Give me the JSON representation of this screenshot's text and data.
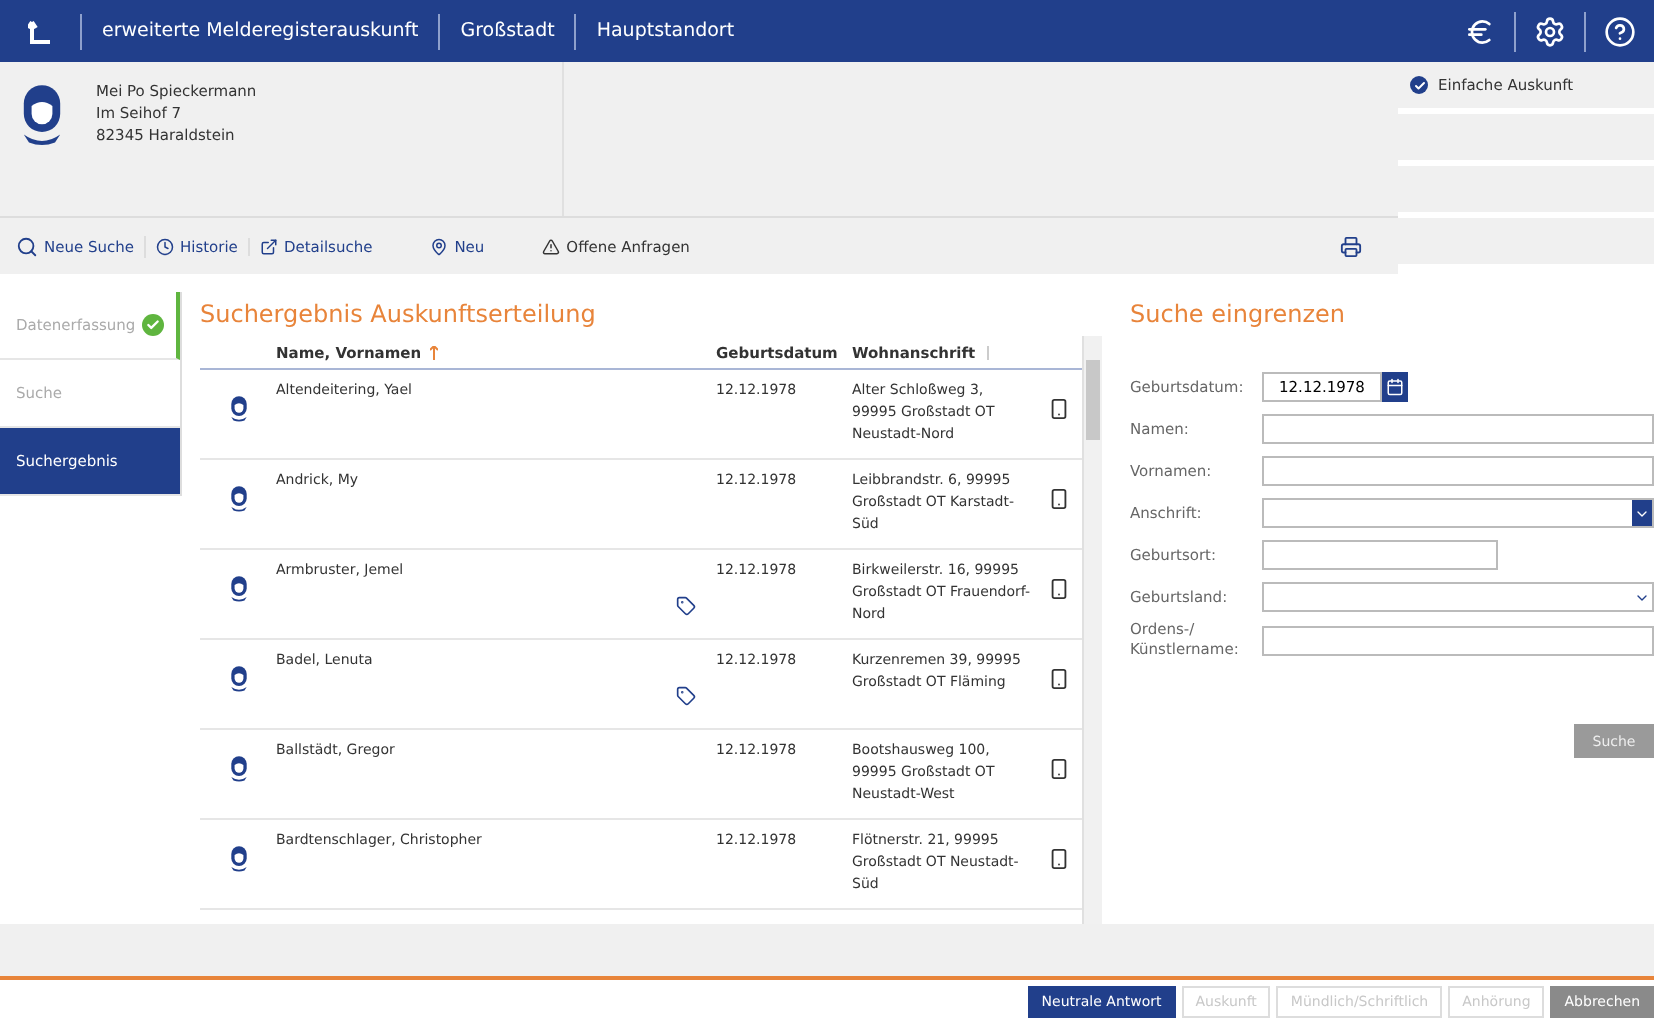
{
  "topbar": {
    "items": [
      "erweiterte Melderegisterauskunft",
      "Großstadt",
      "Hauptstandort"
    ]
  },
  "person": {
    "lines": [
      "Mei Po Spieckermann",
      "Im Seihof 7",
      "82345 Haraldstein"
    ]
  },
  "side_panel": {
    "items": [
      {
        "label": "Einfache Auskunft",
        "checked": true
      }
    ]
  },
  "toolbar": [
    {
      "kind": "search",
      "label": "Neue Suche"
    },
    {
      "kind": "history",
      "label": "Historie"
    },
    {
      "kind": "external",
      "label": "Detailsuche"
    },
    {
      "kind": "pin",
      "label": "Neu"
    },
    {
      "kind": "warning",
      "label": "Offene Anfragen"
    }
  ],
  "steps": [
    {
      "label": "Datenerfassung",
      "done": true,
      "selected": false
    },
    {
      "label": "Suche",
      "done": false,
      "selected": false
    },
    {
      "label": "Suchergebnis",
      "done": false,
      "selected": true
    }
  ],
  "results": {
    "title": "Suchergebnis Auskunftserteilung",
    "columns": [
      "Name, Vornamen",
      "Geburtsdatum",
      "Wohnanschrift"
    ],
    "rows": [
      {
        "name": "Altendeitering, Yael",
        "tagged": false,
        "birth": "12.12.1978",
        "address": "Alter Schloßweg 3, 99995 Großstadt OT Neustadt-Nord"
      },
      {
        "name": "Andrick, My",
        "tagged": false,
        "birth": "12.12.1978",
        "address": "Leibbrandstr. 6, 99995 Großstadt OT Karstadt-Süd"
      },
      {
        "name": "Armbruster, Jemel",
        "tagged": true,
        "birth": "12.12.1978",
        "address": "Birkweilerstr. 16, 99995 Großstadt OT Frauendorf-Nord"
      },
      {
        "name": "Badel, Lenuta",
        "tagged": true,
        "birth": "12.12.1978",
        "address": "Kurzenremen 39, 99995 Großstadt OT Fläming"
      },
      {
        "name": "Ballstädt, Gregor",
        "tagged": false,
        "birth": "12.12.1978",
        "address": "Bootshausweg 100, 99995 Großstadt OT Neustadt-West"
      },
      {
        "name": "Bardtenschlager, Christopher",
        "tagged": false,
        "birth": "12.12.1978",
        "address": "Flötnerstr. 21, 99995 Großstadt OT Neustadt-Süd"
      }
    ]
  },
  "filter": {
    "title": "Suche eingrenzen",
    "fields": [
      {
        "label": "Geburtsdatum:",
        "kind": "date",
        "value": "12.12.1978"
      },
      {
        "label": "Namen:",
        "kind": "text"
      },
      {
        "label": "Vornamen:",
        "kind": "text"
      },
      {
        "label": "Anschrift:",
        "kind": "select-dark"
      },
      {
        "label": "Geburtsort:",
        "kind": "short"
      },
      {
        "label": "Geburtsland:",
        "kind": "select"
      },
      {
        "label": "Ordens-/ Künstlername:",
        "kind": "text"
      }
    ],
    "button": "Suche"
  },
  "footer_buttons": [
    {
      "label": "Neutrale Antwort",
      "disabled": false,
      "kind": "primary"
    },
    {
      "label": "Auskunft",
      "disabled": true,
      "kind": "plain"
    },
    {
      "label": "Mündlich/Schriftlich",
      "disabled": true,
      "kind": "plain"
    },
    {
      "label": "Anhörung",
      "disabled": true,
      "kind": "plain"
    },
    {
      "label": "Abbrechen",
      "disabled": false,
      "kind": "dark"
    }
  ]
}
